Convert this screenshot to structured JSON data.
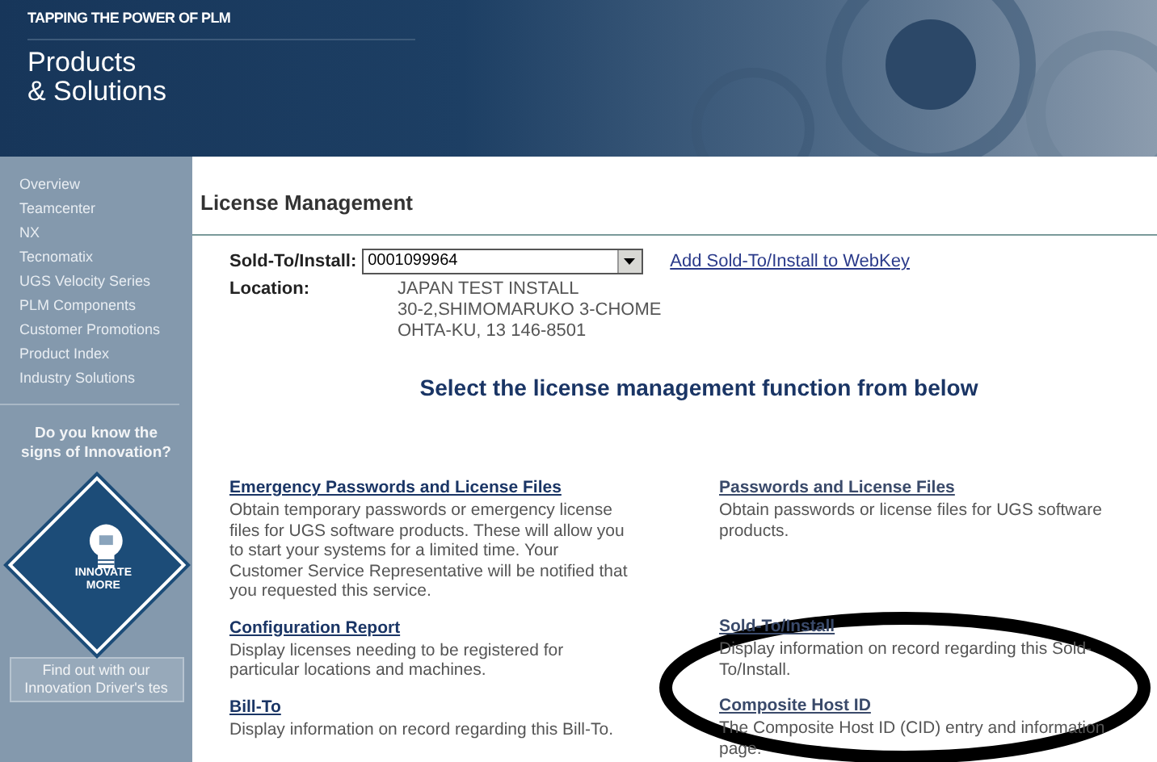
{
  "banner": {
    "tagline": "TAPPING THE POWER OF PLM",
    "title_lines": [
      "Products",
      "& Solutions"
    ]
  },
  "sidebar": {
    "items": [
      {
        "label": "Overview"
      },
      {
        "label": "Teamcenter"
      },
      {
        "label": "NX"
      },
      {
        "label": "Tecnomatix"
      },
      {
        "label": "UGS Velocity Series"
      },
      {
        "label": "PLM Components"
      },
      {
        "label": "Customer Promotions"
      },
      {
        "label": "Product Index"
      },
      {
        "label": "Industry Solutions"
      }
    ],
    "promo": {
      "question": "Do you know the signs of Innovation?",
      "badge_lines": [
        "INNOVATE",
        "MORE"
      ],
      "button": "Find out with our Innovation Driver's tes"
    }
  },
  "page_title": "License Management",
  "form": {
    "sold_to_label": "Sold-To/Install:",
    "sold_to_value": "0001099964",
    "add_link": "Add Sold-To/Install to WebKey",
    "location_label": "Location:",
    "location_lines": [
      "JAPAN TEST INSTALL",
      "30-2,SHIMOMARUKO 3-CHOME",
      "OHTA-KU, 13 146-8501"
    ]
  },
  "section_heading": "Select the license management function from below",
  "function_columns": [
    {
      "items": [
        {
          "title": "Emergency Passwords and License Files",
          "description": "Obtain temporary passwords or emergency license files for UGS software products. These will allow you to start your systems for a limited time. Your Customer Service Representative will be notified that you requested this service."
        },
        {
          "title": "Configuration Report",
          "description": "Display licenses needing to be registered for particular locations and machines."
        },
        {
          "title": "Bill-To",
          "description": "Display information on record regarding this Bill-To."
        }
      ]
    },
    {
      "items": [
        {
          "title": "Passwords and License Files",
          "description": "Obtain passwords or license files for UGS software products."
        },
        {
          "title": "Sold-To/Install",
          "description": "Display information on record regarding this Sold-To/Install."
        },
        {
          "title": "Composite Host ID",
          "description": "The Composite Host ID (CID) entry and information page."
        }
      ]
    }
  ],
  "annotations": [
    {
      "kind": "ellipse"
    }
  ]
}
